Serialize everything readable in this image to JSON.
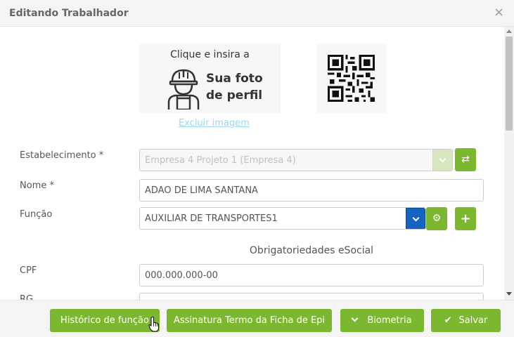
{
  "dialog": {
    "title": "Editando Trabalhador",
    "close_label": "×"
  },
  "photo": {
    "prompt": "Clique e insira a",
    "main_line1": "Sua foto",
    "main_line2": "de perfil",
    "remove_link": "Excluir imagem"
  },
  "form": {
    "estabelecimento": {
      "label": "Estabelecimento *",
      "value": "Empresa 4 Projeto 1 (Empresa 4)"
    },
    "nome": {
      "label": "Nome *",
      "value": "ADAO DE LIMA SANTANA"
    },
    "funcao": {
      "label": "Função",
      "value": "AUXILIAR DE TRANSPORTES1"
    },
    "section_title": "Obrigatoriedades eSocial",
    "cpf": {
      "label": "CPF",
      "value": "000.000.000-00"
    },
    "rg": {
      "label": "RG",
      "value": ""
    }
  },
  "footer": {
    "historico": "Histórico de função",
    "assinatura": "Assinatura Termo da Ficha de Epi",
    "biometria": "Biometria",
    "salvar": "Salvar"
  },
  "icons": {
    "swap": "⇄",
    "gear": "⚙",
    "plus": "+",
    "check": "✔"
  },
  "colors": {
    "accent_green": "#7cb82f",
    "dropdown_blue": "#1565c0",
    "link_light_blue": "#9fd5ee"
  }
}
